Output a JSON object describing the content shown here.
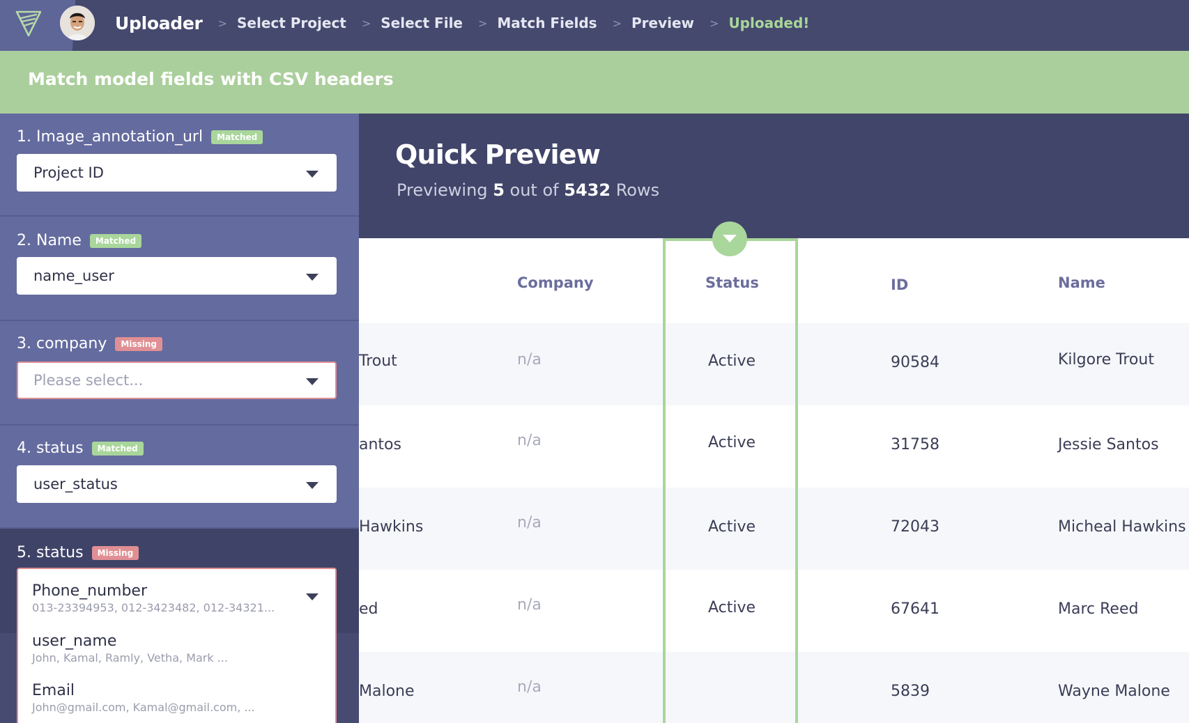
{
  "topbar": {
    "app_name": "Uploader",
    "steps": [
      "Select Project",
      "Select File",
      "Match Fields",
      "Preview",
      "Uploaded!"
    ]
  },
  "banner": {
    "title": "Match model fields with CSV headers"
  },
  "fields": [
    {
      "label": "1. Image_annotation_url",
      "badge": "Matched",
      "value": "Project ID"
    },
    {
      "label": "2. Name",
      "badge": "Matched",
      "value": "name_user"
    },
    {
      "label": "3. company",
      "badge": "Missing",
      "placeholder": "Please select..."
    },
    {
      "label": "4. status",
      "badge": "Matched",
      "value": "user_status"
    },
    {
      "label": "5. status",
      "badge": "Missing"
    }
  ],
  "dropdown": {
    "options": [
      {
        "title": "Phone_number",
        "sample": "013-23394953, 012-3423482, 012-34321..."
      },
      {
        "title": "user_name",
        "sample": "John, Kamal, Ramly, Vetha, Mark ..."
      },
      {
        "title": "Email",
        "sample": "John@gmail.com, Kamal@gmail.com, ..."
      }
    ]
  },
  "preview": {
    "title": "Quick Preview",
    "sub_prefix": "Previewing",
    "shown": "5",
    "sub_middle": "out of",
    "total": "5432",
    "sub_suffix": "Rows"
  },
  "table": {
    "headers": {
      "company": "Company",
      "status": "Status",
      "id": "ID",
      "name": "Name"
    },
    "rows": [
      {
        "partial": "Trout",
        "company": "n/a",
        "status": "Active",
        "id": "90584",
        "name": "Kilgore Trout"
      },
      {
        "partial": "antos",
        "company": "n/a",
        "status": "Active",
        "id": "31758",
        "name": "Jessie Santos"
      },
      {
        "partial": "Hawkins",
        "company": "n/a",
        "status": "Active",
        "id": "72043",
        "name": "Micheal Hawkins"
      },
      {
        "partial": "ed",
        "company": "n/a",
        "status": "Active",
        "id": "67641",
        "name": "Marc Reed"
      },
      {
        "partial": "Malone",
        "company": "n/a",
        "status": "",
        "id": "5839",
        "name": "Wayne Malone"
      }
    ]
  },
  "colors": {
    "accent_green": "#a9d69b",
    "missing_red": "#e08f94",
    "nav_bg": "#45496e",
    "panel_bg": "#646b9e"
  },
  "icons": {
    "logo": "shield-logo-icon",
    "status_toggle": "chevron-down-icon",
    "select": "caret-down-icon"
  }
}
